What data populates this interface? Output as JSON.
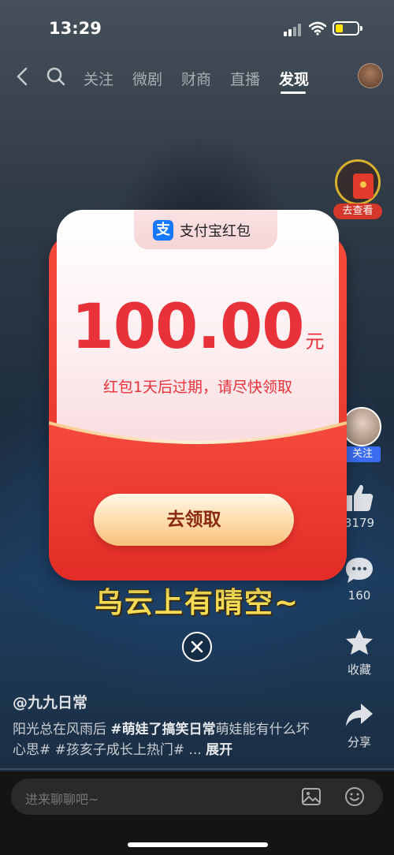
{
  "status_bar": {
    "time": "13:29",
    "battery_color": "#ffe600"
  },
  "top_nav": {
    "tabs": [
      "关注",
      "微剧",
      "财商",
      "直播",
      "发现"
    ],
    "active_tab": "发现"
  },
  "red_packet_widget": {
    "label": "去查看"
  },
  "video": {
    "subtitle": "乌云上有晴空~",
    "author": "@九九日常",
    "description_plain_1": "阳光总在风雨后 ",
    "description_tag_1": "#萌娃了搞笑日常",
    "description_plain_2": "萌娃能有什么坏心思# #孩亥子成长上热门# ... ",
    "description_more": "展开"
  },
  "actions": {
    "follow_label": "关注",
    "like_count": "3179",
    "comment_count": "160",
    "favorite_label": "收藏",
    "share_label": "分享"
  },
  "comment_bar": {
    "placeholder": "进来聊聊吧~"
  },
  "modal": {
    "brand": "支付宝红包",
    "brand_logo_char": "支",
    "amount": "100.00",
    "unit": "元",
    "expiry_text": "红包1天后过期，请尽快领取",
    "claim_label": "去领取",
    "accent_color": "#e9313a",
    "brand_color": "#1677ff"
  }
}
